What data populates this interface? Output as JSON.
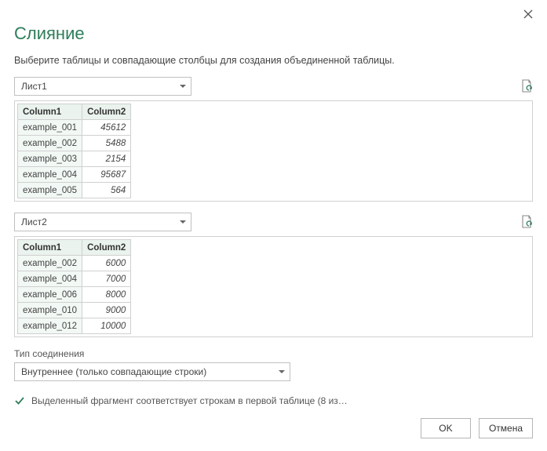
{
  "title": "Слияние",
  "subtitle": "Выберите таблицы и совпадающие столбцы для создания объединенной таблицы.",
  "table1": {
    "selected": "Лист1",
    "columns": [
      "Column1",
      "Column2"
    ],
    "rows": [
      [
        "example_001",
        "45612"
      ],
      [
        "example_002",
        "5488"
      ],
      [
        "example_003",
        "2154"
      ],
      [
        "example_004",
        "95687"
      ],
      [
        "example_005",
        "564"
      ]
    ]
  },
  "table2": {
    "selected": "Лист2",
    "columns": [
      "Column1",
      "Column2"
    ],
    "rows": [
      [
        "example_002",
        "6000"
      ],
      [
        "example_004",
        "7000"
      ],
      [
        "example_006",
        "8000"
      ],
      [
        "example_010",
        "9000"
      ],
      [
        "example_012",
        "10000"
      ]
    ]
  },
  "join": {
    "label": "Тип соединения",
    "selected": "Внутреннее (только совпадающие строки)"
  },
  "status": "Выделенный фрагмент соответствует строкам в первой таблице (8 из…",
  "buttons": {
    "ok": "OK",
    "cancel": "Отмена"
  }
}
